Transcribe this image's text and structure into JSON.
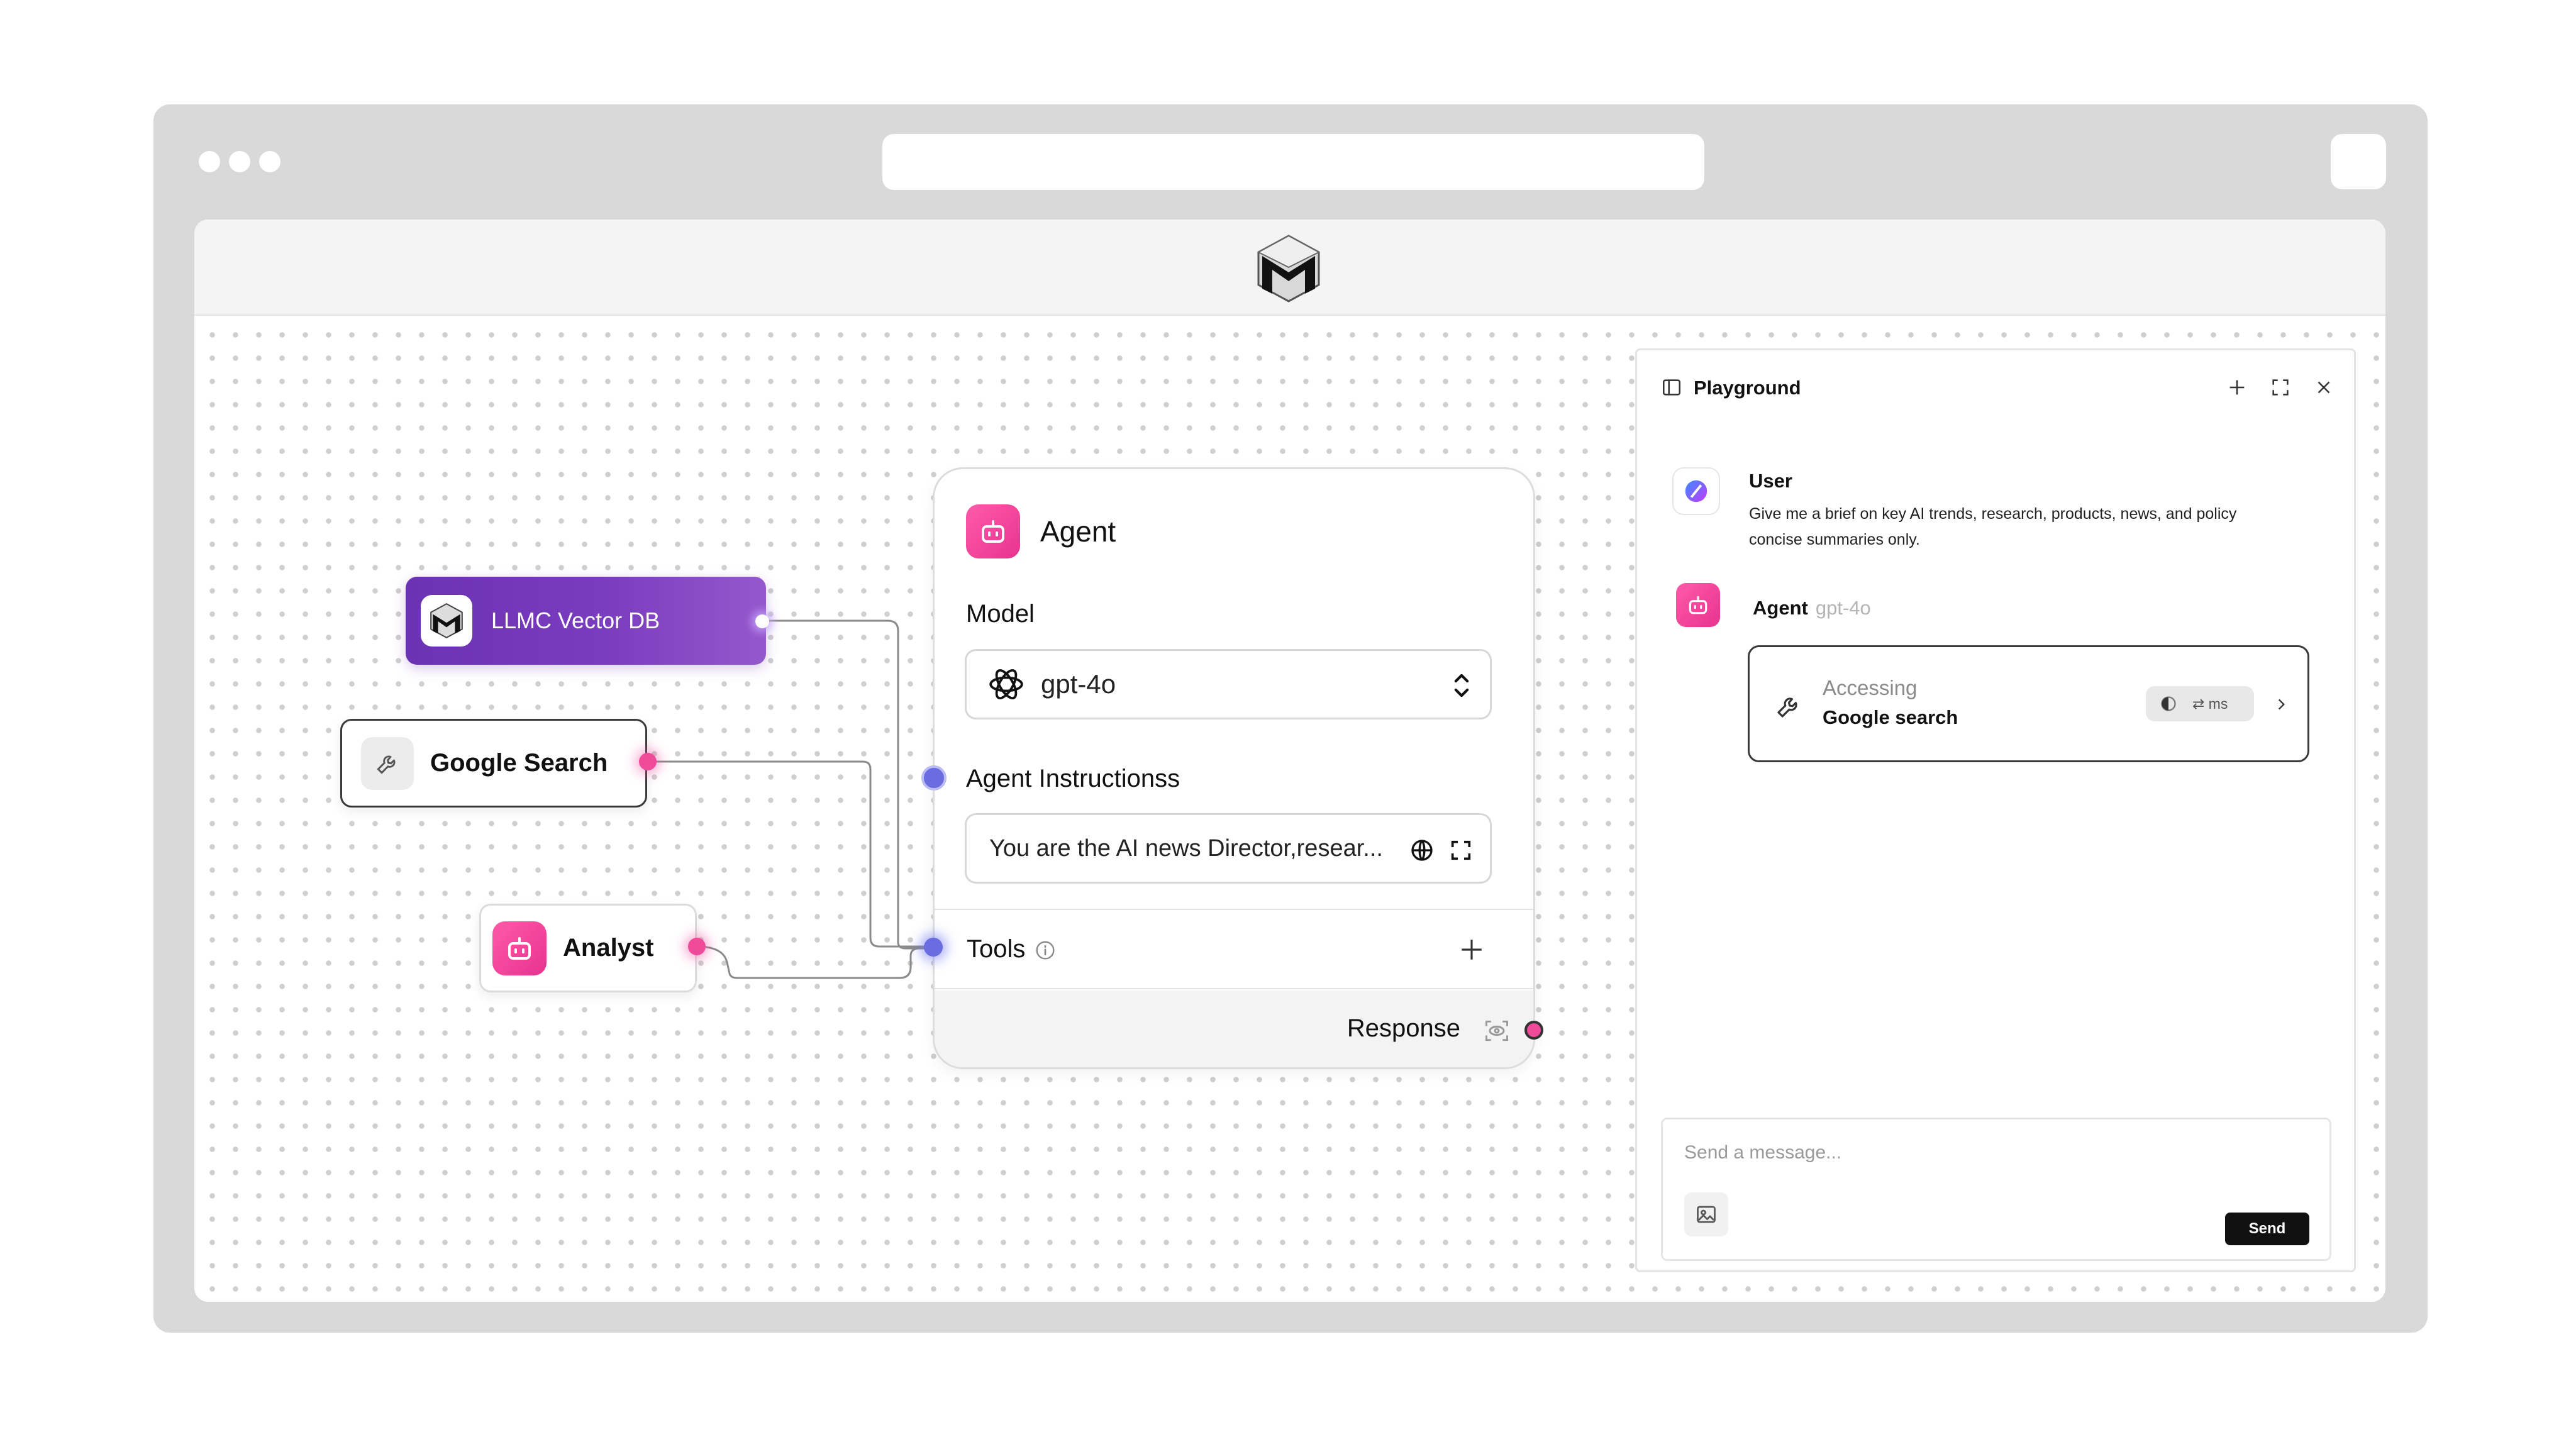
{
  "app": {
    "logo_icon": "llmc-logo-icon"
  },
  "canvas": {
    "nodes": {
      "vector_db": {
        "label": "LLMC Vector DB",
        "icon": "llmc-logo-icon",
        "color": "#6b32b4"
      },
      "google_search": {
        "label": "Google Search",
        "icon": "wrench-icon"
      },
      "analyst": {
        "label": "Analyst",
        "icon": "robot-icon"
      }
    }
  },
  "agent": {
    "title": "Agent",
    "model_label": "Model",
    "model_value": "gpt-4o",
    "instructions_label": "Agent Instructionss",
    "instructions_value": "You are the AI news Director,resear...",
    "tools_label": "Tools",
    "response_label": "Response"
  },
  "playground": {
    "title": "Playground",
    "user": {
      "name": "User",
      "message": "Give me a brief on key AI trends, research, products, news, and policy concise summaries only."
    },
    "agent": {
      "name": "Agent",
      "model": "gpt-4o",
      "status_top": "Accessing",
      "status_bottom": "Google search",
      "timing": "⇄ ms"
    },
    "composer": {
      "placeholder": "Send a message...",
      "send_label": "Send"
    }
  },
  "colors": {
    "accent_pink": "#e8338f",
    "accent_purple": "#6b32b4",
    "port_blue": "#6a6ce0"
  }
}
